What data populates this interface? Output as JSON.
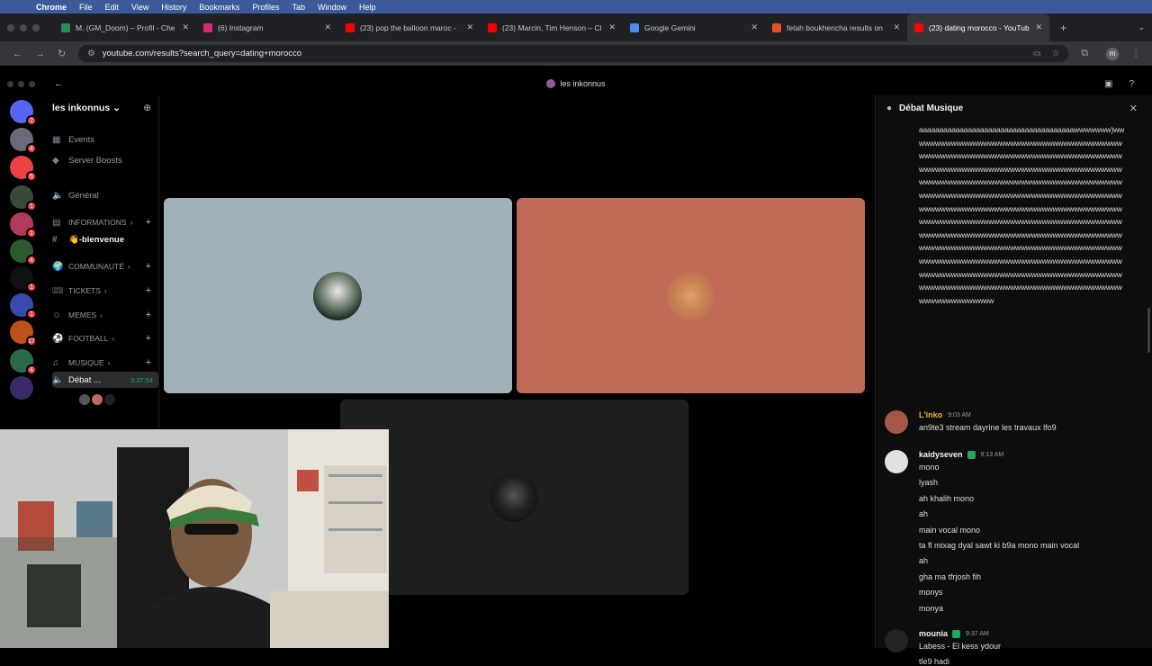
{
  "menubar": {
    "app": "Chrome",
    "items": [
      "File",
      "Edit",
      "View",
      "History",
      "Bookmarks",
      "Profiles",
      "Tab",
      "Window",
      "Help"
    ]
  },
  "tabs": [
    {
      "title": "M. (GM_Doom) – Profil - Che",
      "icon": "green-person-icon",
      "color": "#2e8b57"
    },
    {
      "title": "(6) Instagram",
      "icon": "instagram-icon",
      "color": "#d62976"
    },
    {
      "title": "(23) pop the balloon maroc -",
      "icon": "youtube-icon",
      "color": "#ff0000"
    },
    {
      "title": "(23) Marcin, Tim Henson – Cl",
      "icon": "youtube-icon",
      "color": "#ff0000"
    },
    {
      "title": "Google Gemini",
      "icon": "gemini-icon",
      "color": "#4a8df6"
    },
    {
      "title": "fetah boukhencha results on",
      "icon": "orange-site-icon",
      "color": "#e2512a"
    },
    {
      "title": "(23) dating morocco - YouTub",
      "icon": "youtube-icon",
      "color": "#ff0000",
      "active": true
    }
  ],
  "address": {
    "url": "youtube.com/results?search_query=dating+morocco"
  },
  "discord": {
    "window_title": "les inkonnus",
    "server_name": "les inkonnus",
    "server_badges": [
      "2",
      "4",
      "5",
      "1",
      "1",
      "4",
      "1",
      "1",
      "17",
      "4"
    ],
    "channels": [
      {
        "label": "Events",
        "icon": "calendar-icon",
        "type": "item"
      },
      {
        "label": "Server Boosts",
        "icon": "boost-icon",
        "type": "item"
      },
      {
        "label": "Général",
        "icon": "speaker-icon",
        "type": "item"
      },
      {
        "label": "INFORMATIONS",
        "icon": "newspaper-icon",
        "type": "cat"
      },
      {
        "label": "👋-bienvenue",
        "icon": "hash-icon",
        "type": "bright"
      },
      {
        "label": "COMMUNAUTÉ",
        "icon": "globe-icon",
        "type": "cat"
      },
      {
        "label": "TICKETS",
        "icon": "ticket-icon",
        "type": "cat"
      },
      {
        "label": "MEMES",
        "icon": "emoji-icon",
        "type": "cat"
      },
      {
        "label": "FOOTBALL",
        "icon": "soccer-ball-icon",
        "type": "cat"
      },
      {
        "label": "MUSIQUE",
        "icon": "music-note-icon",
        "type": "cat"
      },
      {
        "label": "Débat ...",
        "icon": "speaker-icon",
        "type": "active",
        "timer": "3:37:54"
      }
    ]
  },
  "chat": {
    "title": "Débat Musique",
    "spam_text": "aaaaaaaaaaaaaaaaaaaaaaaaaaaaaaaaaaaaaawwwwwww)wwwwwwwwwwwwwwwwwwwwwwwwwwwwwwwwwwwwwwwwwwwwwwwwwwwwwwwwwwwwwwwwwwwwwwwwwwwwwwwwwwwwwwwwwwwwwwwwwwwwwwwwwwwwwwwwwwwwwwwwwwwwwwwwwwwwwwwwwwwwwwwwwwwwwwwwwwwwwwwwwwwwwwwwwwwwwwwwwwwwwwwwwwwwwwwwwwwwwwwwwwwwwwwwwwwwwwwwwwwwwwwwwwwwwwwwwwwwwwwwwwwwwwwwwwwwwwwwwwwwwwwwwwwwwwwwwwwwwwwwwwwwwwwwwwwwwwwwwwwwwwwwwwwwwwwwwwwwwwwwwwwwwwwwwwwwwwwwwwwwwwwwwwwwwwwwwwwwwwwwwwwwwwwwwwwwwwwwwwwwwwwwwwwwwwwwwwwwwwwwwwwwwwwwwwwwwwwwwwwwwwwwwwwwwwwwwwwwwwwwwwwwwwwwwwwwwwwwwwwwwwwwwwwwwwww",
    "messages": [
      {
        "author": "L'inko",
        "name_color": "#f0b232",
        "time": "9:03 AM",
        "lines": [
          "an9te3 stream dayrine les travaux lfo9"
        ],
        "avatar_color": "#a5564a",
        "verified": false
      },
      {
        "author": "kaidyseven",
        "name_color": "#f2f3f5",
        "time": "9:13 AM",
        "lines": [
          "mono",
          "lyash",
          "ah khalih mono",
          "ah",
          "main vocal mono",
          "ta fl mixag dyal sawt ki b9a mono main vocal",
          "ah",
          "gha ma tfrjosh fih",
          "monys",
          "monya"
        ],
        "avatar_color": "#e0e0e0",
        "verified": true
      },
      {
        "author": "mounia",
        "name_color": "#f2f3f5",
        "time": "9:37 AM",
        "lines": [
          "Labess - El kess ydour",
          "tle9 hadi"
        ],
        "avatar_color": "#222",
        "verified": true
      }
    ]
  },
  "colors": {
    "tile_left": "#a0b2b8",
    "tile_right": "#c06a58",
    "tile_bottom": "#1e1f1f"
  }
}
